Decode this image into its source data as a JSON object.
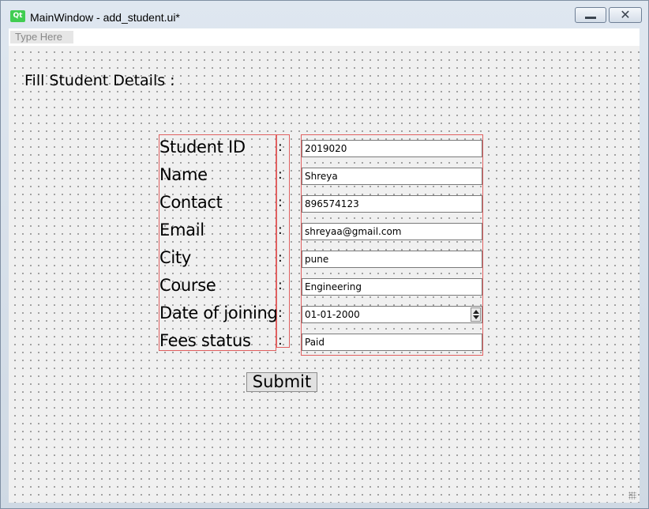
{
  "window": {
    "title": "MainWindow - add_student.ui*",
    "logo_text": "Qt",
    "minimize_icon": "minimize-icon",
    "close_icon": "close-icon",
    "close_glyph": "✕"
  },
  "menubar": {
    "placeholder": "Type Here"
  },
  "form": {
    "heading": "Fill Student Details :",
    "rows": [
      {
        "label": "Student ID",
        "colon": ":",
        "value": "2019020"
      },
      {
        "label": "Name",
        "colon": ":",
        "value": "Shreya"
      },
      {
        "label": "Contact",
        "colon": ":",
        "value": "896574123"
      },
      {
        "label": "Email",
        "colon": ":",
        "value": "shreyaa@gmail.com"
      },
      {
        "label": "City",
        "colon": ":",
        "value": "pune"
      },
      {
        "label": "Course",
        "colon": ":",
        "value": "Engineering"
      },
      {
        "label": "Date of joining",
        "colon": ":",
        "value": "01-01-2000"
      },
      {
        "label": "Fees status",
        "colon": ":",
        "value": "Paid"
      }
    ],
    "submit_label": "Submit"
  },
  "colors": {
    "layout_outline": "#e06060",
    "qt_green": "#41cd52"
  }
}
